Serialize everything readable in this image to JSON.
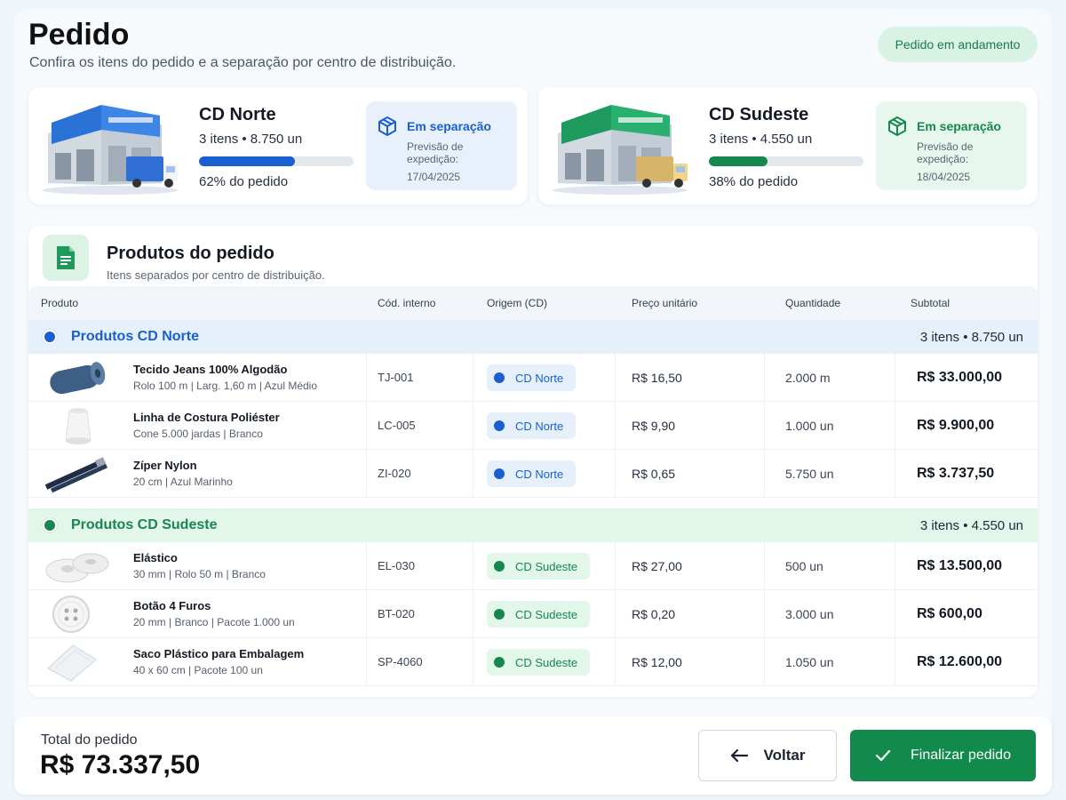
{
  "header": {
    "title": "Pedido",
    "subtitle": "Confira os itens do pedido e a separação por centro de distribuição.",
    "status": "Pedido em andamento"
  },
  "cds": {
    "norte": {
      "name": "CD Norte",
      "stats": "3 itens • 8.750 un",
      "progress": 0.62,
      "pct_label": "62% do pedido",
      "status": "Em separação",
      "ship_label": "Previsão de expedição:",
      "ship_date": "17/04/2025",
      "color": "#1a5fd0"
    },
    "sudeste": {
      "name": "CD Sudeste",
      "stats": "3 itens • 4.550 un",
      "progress": 0.38,
      "pct_label": "38% do pedido",
      "status": "Em separação",
      "ship_label": "Previsão de expedição:",
      "ship_date": "18/04/2025",
      "color": "#16874f"
    }
  },
  "products": {
    "title": "Produtos do pedido",
    "subtitle": "Itens separados por centro de distribuição.",
    "columns": [
      "Produto",
      "Cód. interno",
      "Origem (CD)",
      "Preço unitário",
      "Quantidade",
      "Subtotal"
    ],
    "groups": [
      {
        "label": "Produtos CD Norte",
        "count": "3 itens • 8.750 un",
        "rows": [
          {
            "icon": "fabric-roll-icon",
            "name": "Tecido Jeans 100% Algodão",
            "desc": "Rolo 100 m | Larg. 1,60 m | Azul Médio",
            "code": "TJ-001",
            "origin": "CD Norte",
            "price": "R$ 16,50",
            "qty": "2.000 m",
            "subtotal": "R$ 33.000,00"
          },
          {
            "icon": "thread-cone-icon",
            "name": "Linha de Costura Poliéster",
            "desc": "Cone 5.000 jardas | Branco",
            "code": "LC-005",
            "origin": "CD Norte",
            "price": "R$ 9,90",
            "qty": "1.000 un",
            "subtotal": "R$ 9.900,00"
          },
          {
            "icon": "zipper-icon",
            "name": "Zíper Nylon",
            "desc": "20 cm | Azul Marinho",
            "code": "ZI-020",
            "origin": "CD Norte",
            "price": "R$ 0,65",
            "qty": "5.750 un",
            "subtotal": "R$ 3.737,50"
          }
        ]
      },
      {
        "label": "Produtos CD Sudeste",
        "count": "3 itens • 4.550 un",
        "rows": [
          {
            "icon": "elastic-roll-icon",
            "name": "Elástico",
            "desc": "30 mm | Rolo 50 m | Branco",
            "code": "EL-030",
            "origin": "CD Sudeste",
            "price": "R$ 27,00",
            "qty": "500 un",
            "subtotal": "R$ 13.500,00"
          },
          {
            "icon": "button-icon",
            "name": "Botão 4 Furos",
            "desc": "20 mm | Branco | Pacote 1.000 un",
            "code": "BT-020",
            "origin": "CD Sudeste",
            "price": "R$ 0,20",
            "qty": "3.000 un",
            "subtotal": "R$ 600,00"
          },
          {
            "icon": "plastic-bag-icon",
            "name": "Saco Plástico para Embalagem",
            "desc": "40 x 60 cm | Pacote 100 un",
            "code": "SP-4060",
            "origin": "CD Sudeste",
            "price": "R$ 12,00",
            "qty": "1.050 un",
            "subtotal": "R$ 12.600,00"
          }
        ]
      }
    ]
  },
  "footer": {
    "total_label": "Total do pedido",
    "total_value": "R$ 73.337,50",
    "back_label": "Voltar",
    "finish_label": "Finalizar pedido"
  }
}
